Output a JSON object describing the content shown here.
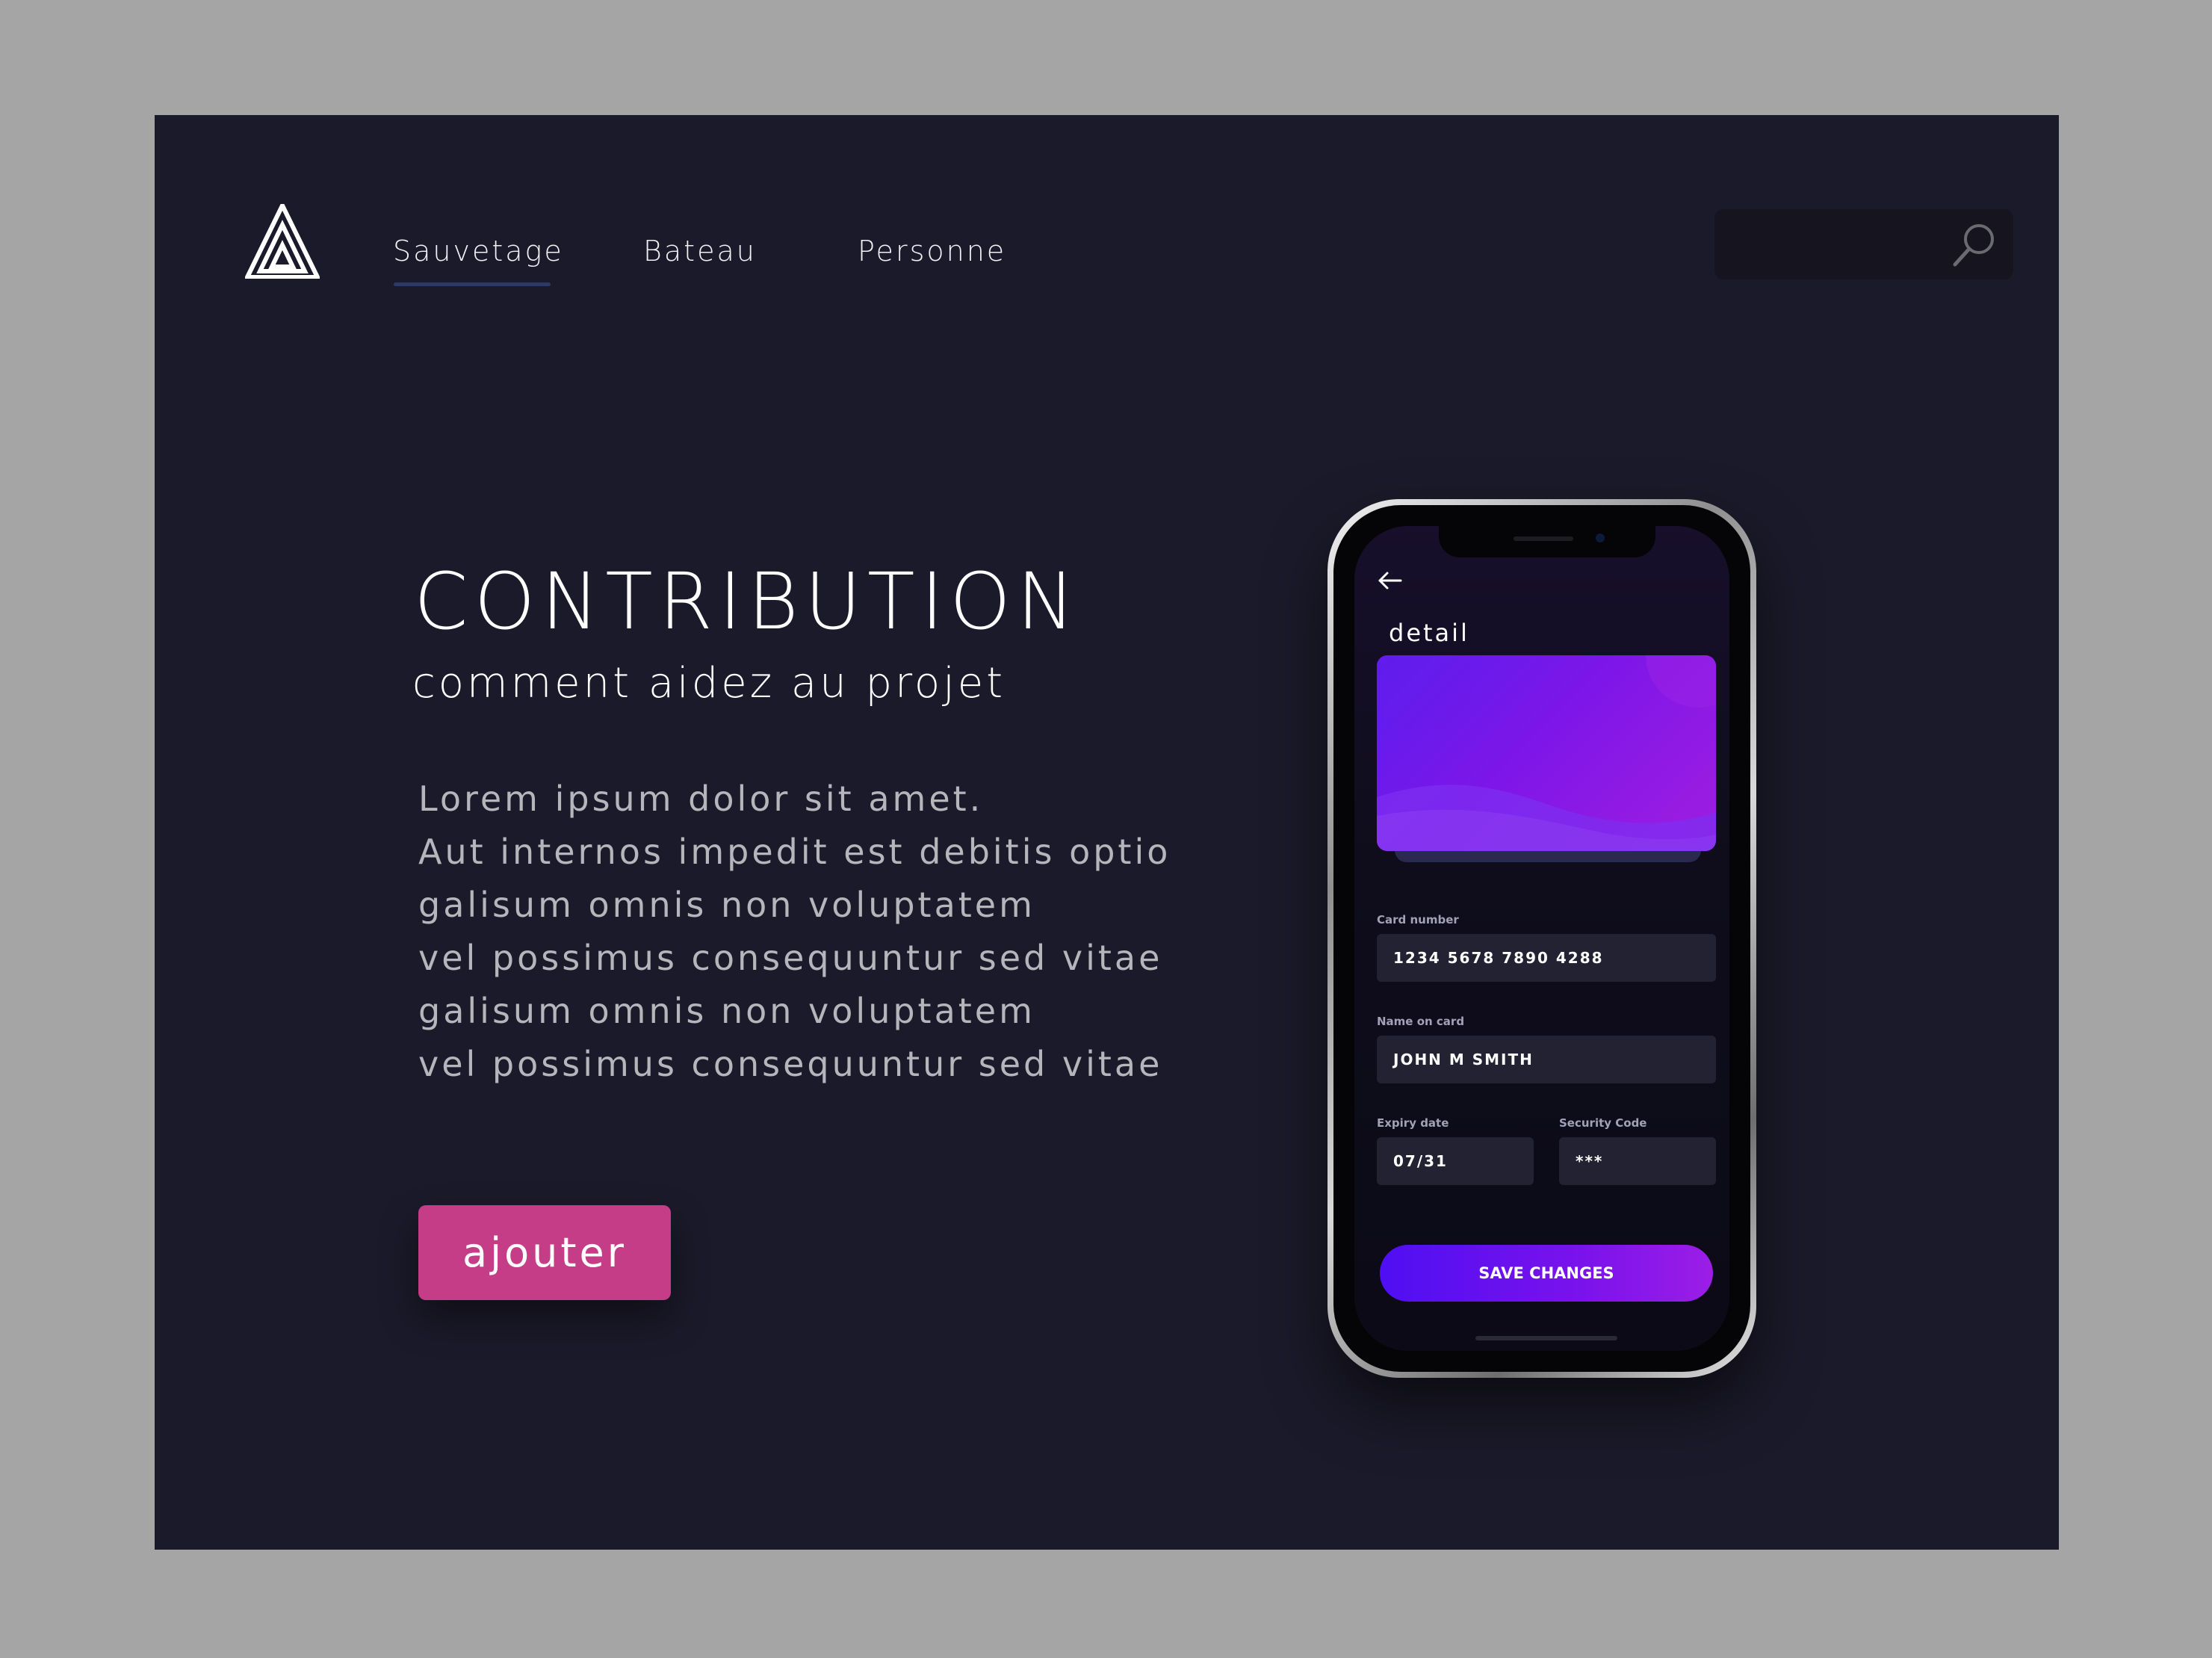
{
  "nav": {
    "items": [
      {
        "label": "Sauvetage",
        "active": true
      },
      {
        "label": "Bateau",
        "active": false
      },
      {
        "label": "Personne",
        "active": false
      }
    ]
  },
  "search": {
    "placeholder": "",
    "icon": "search-icon"
  },
  "hero": {
    "title": "CONTRIBUTION",
    "subtitle": "comment aidez au projet",
    "body_lines": [
      "Lorem ipsum dolor sit amet.",
      "Aut internos impedit est debitis optio",
      "galisum omnis non voluptatem",
      "vel possimus consequuntur sed vitae",
      "galisum omnis non voluptatem",
      "vel possimus consequuntur sed vitae"
    ],
    "cta_label": "ajouter"
  },
  "phone": {
    "screen_title": "detail",
    "card_number_label": "Card number",
    "card_number": "1234 5678 7890 4288",
    "name_label": "Name on card",
    "name": "JOHN M SMITH",
    "expiry_label": "Expiry date",
    "expiry": "07/31",
    "security_label": "Security Code",
    "security": "***",
    "save_label": "SAVE CHANGES"
  },
  "colors": {
    "background": "#1b1a2a",
    "outer": "#a5a5a5",
    "accent_pink": "#c63d87",
    "accent_purple": "#7a12ec",
    "nav_underline": "#2a3c66"
  }
}
